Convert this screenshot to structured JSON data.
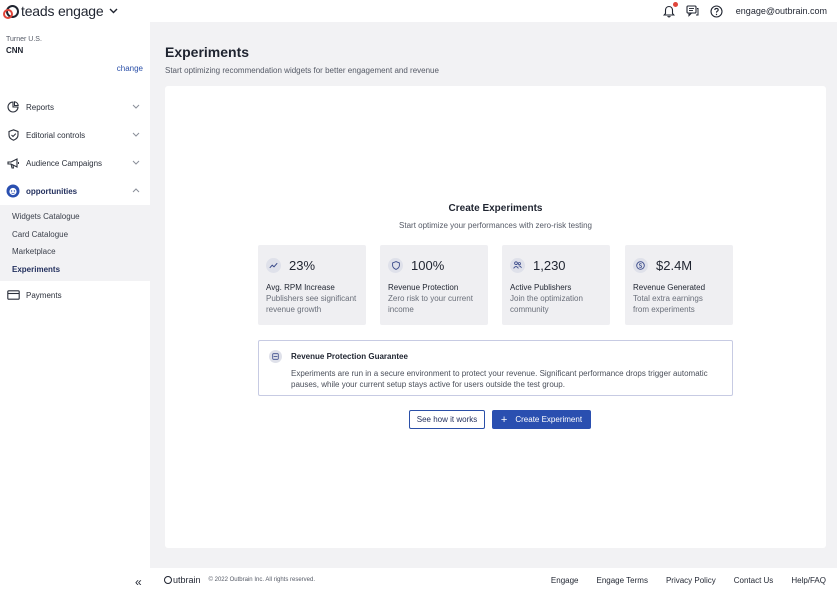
{
  "header": {
    "logo_text": "teads engage",
    "user_email": "engage@outbrain.com",
    "icons": [
      "chevron-down-icon",
      "bell-icon",
      "chat-icon",
      "help-icon"
    ]
  },
  "sidebar": {
    "account_org": "Turner U.S.",
    "account_name": "CNN",
    "change_label": "change",
    "items": [
      {
        "label": "Reports",
        "icon": "reports-icon"
      },
      {
        "label": "Editorial controls",
        "icon": "shield-icon"
      },
      {
        "label": "Audience Campaigns",
        "icon": "megaphone-icon"
      },
      {
        "label": "opportunities",
        "icon": "opportunities-icon"
      },
      {
        "label": "Payments",
        "icon": "payments-icon"
      }
    ],
    "sub_items": [
      {
        "label": "Widgets Catalogue"
      },
      {
        "label": "Card Catalogue"
      },
      {
        "label": "Marketplace"
      },
      {
        "label": "Experiments"
      }
    ],
    "collapse_label": "«"
  },
  "main": {
    "title": "Experiments",
    "subtitle": "Start optimizing recommendation widgets for better engagement and revenue",
    "hero_title": "Create Experiments",
    "hero_subtitle": "Start optimize your performances with zero-risk testing",
    "stats": [
      {
        "value": "23%",
        "title": "Avg. RPM Increase",
        "desc1": "Publishers see significant",
        "desc2": "revenue growth",
        "icon": "trend-icon"
      },
      {
        "value": "100%",
        "title": "Revenue Protection",
        "desc1": "Zero risk to your current",
        "desc2": "income",
        "icon": "shield-icon"
      },
      {
        "value": "1,230",
        "title": "Active Publishers",
        "desc1": "Join the optimization",
        "desc2": "community",
        "icon": "users-icon"
      },
      {
        "value": "$2.4M",
        "title": "Revenue Generated",
        "desc1": "Total extra earnings",
        "desc2": "from experiments",
        "icon": "dollar-icon"
      }
    ],
    "guarantee": {
      "title": "Revenue Protection Guarantee",
      "line1": "Experiments are run in a secure environment to protect your revenue. Significant performance drops trigger automatic",
      "line2": "pauses, while your current setup stays active for users outside the test group."
    },
    "buttons": {
      "how_it_works": "See how it works",
      "create": "Create Experiment"
    }
  },
  "footer": {
    "logo_text": "utbrain",
    "copyright": "© 2022 Outbrain Inc. All rights reserved.",
    "links": [
      "Engage",
      "Engage Terms",
      "Privacy Policy",
      "Contact Us",
      "Help/FAQ"
    ]
  },
  "colors": {
    "accent": "#2a4fb0",
    "brand_red": "#e0453a",
    "background": "#f2f2f4"
  }
}
